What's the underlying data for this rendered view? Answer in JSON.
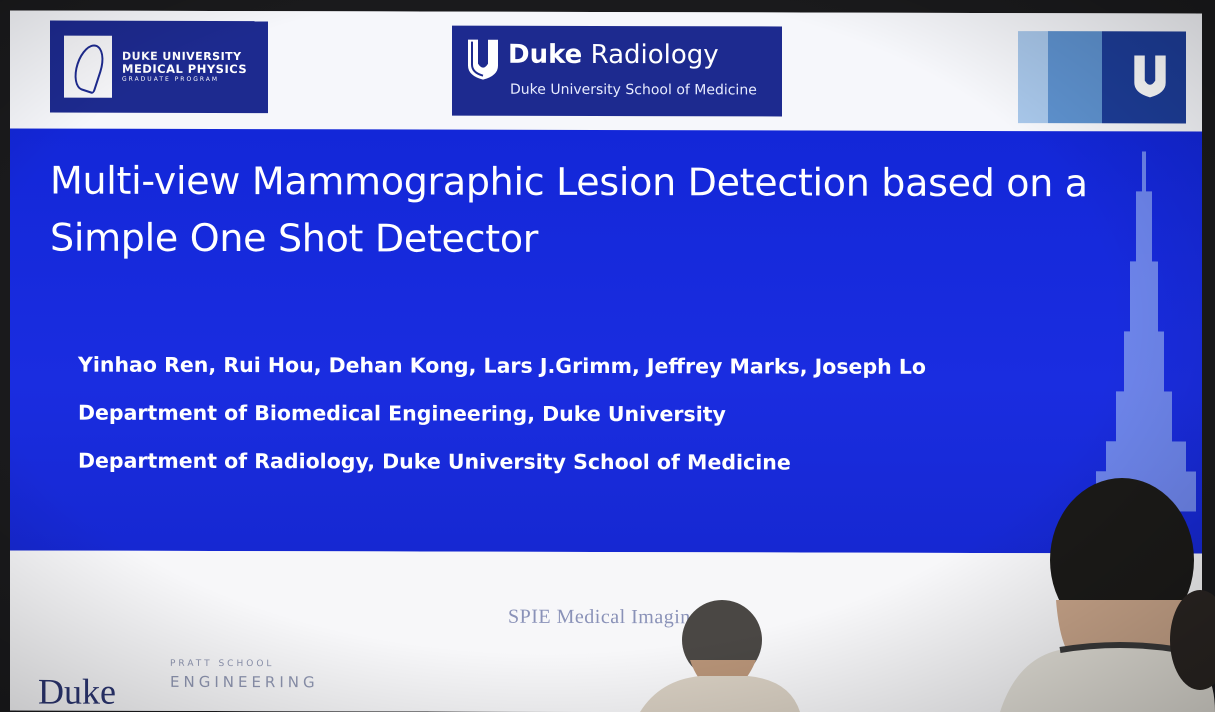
{
  "header": {
    "mp_logo": {
      "line1": "DUKE UNIVERSITY",
      "line2": "MEDICAL PHYSICS",
      "line3": "GRADUATE PROGRAM"
    },
    "radiology_logo": {
      "name_bold": "Duke",
      "name_rest": " Radiology",
      "subtitle": "Duke University School of Medicine"
    }
  },
  "slide": {
    "title": "Multi-view Mammographic Lesion Detection based on a Simple One Shot Detector",
    "authors": "Yinhao Ren, Rui Hou, Dehan Kong, Lars J.Grimm, Jeffrey Marks, Joseph Lo",
    "affiliation1": "Department of Biomedical Engineering, Duke University",
    "affiliation2": "Department of Radiology, Duke University School of Medicine"
  },
  "footer": {
    "conference": "SPIE Medical Imaging 2018",
    "duke_wordmark": "Duke",
    "pratt_line1": "PRATT SCHOOL",
    "pratt_line2": "ENGINEERING"
  },
  "colors": {
    "panel_blue": "#1a2de0",
    "logo_navy": "#1d2a8f",
    "light_blue": "#a8c7ea",
    "mid_blue": "#5e92cf"
  }
}
